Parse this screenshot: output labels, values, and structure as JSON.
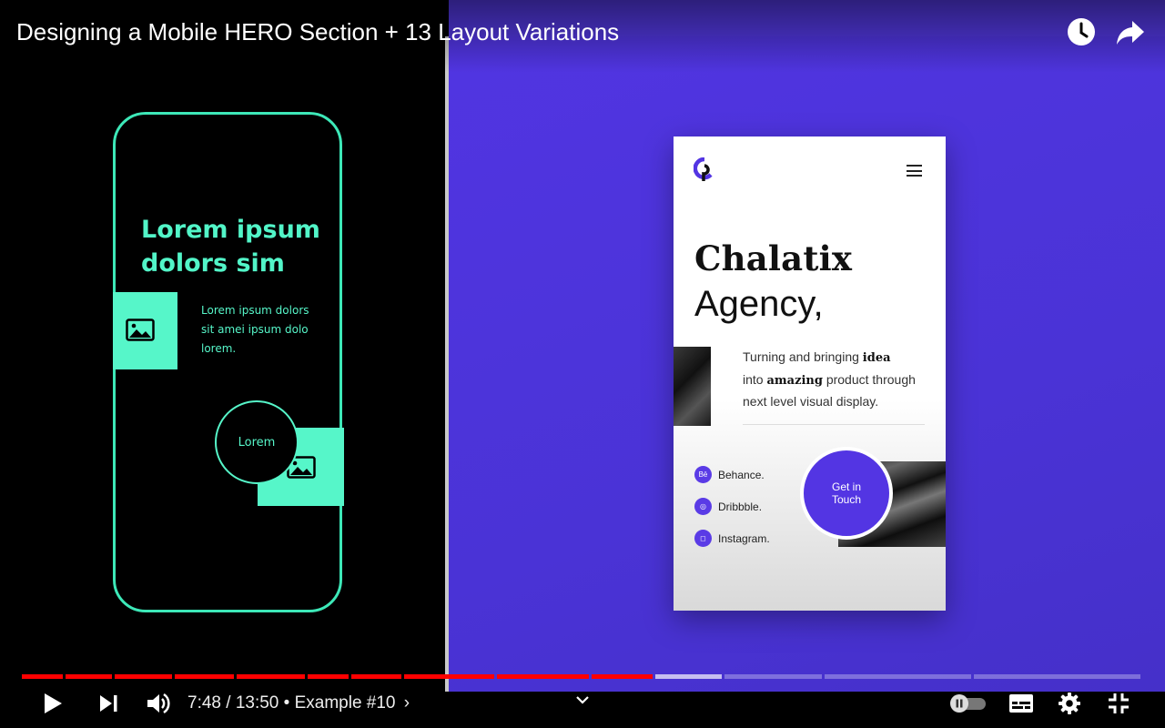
{
  "video": {
    "title": "Designing a Mobile HERO Section + 13 Layout Variations"
  },
  "left_panel": {
    "heading_line1": "Lorem ipsum",
    "heading_line2": "dolors sim",
    "body_line1": "Lorem ipsum dolors",
    "body_line2": "sit amei ipsum dolo",
    "body_line3": "lorem.",
    "circle_label": "Lorem",
    "accent_color": "#56f6c9"
  },
  "right_panel": {
    "title_line1": "Chalatix",
    "title_line2": "Agency,",
    "desc_part1": "Turning and bringing ",
    "desc_bold1": "idea",
    "desc_part2": "into ",
    "desc_bold2": "amazing",
    "desc_part3": " product through",
    "desc_part4": "next level visual display.",
    "social": [
      {
        "icon": "behance-icon",
        "glyph": "Bē",
        "label": "Behance."
      },
      {
        "icon": "dribbble-icon",
        "glyph": "◎",
        "label": "Dribbble."
      },
      {
        "icon": "instagram-icon",
        "glyph": "◻",
        "label": "Instagram."
      }
    ],
    "cta_line1": "Get in",
    "cta_line2": "Touch",
    "accent_color": "#5335e3"
  },
  "controls": {
    "current_time": "7:48",
    "separator": " / ",
    "duration": "13:50",
    "chapter": " • Example #10",
    "chapter_chevron": "›",
    "progress_fraction": 0.564,
    "buffered_fraction": 0.625,
    "played_color": "#ff0000"
  }
}
